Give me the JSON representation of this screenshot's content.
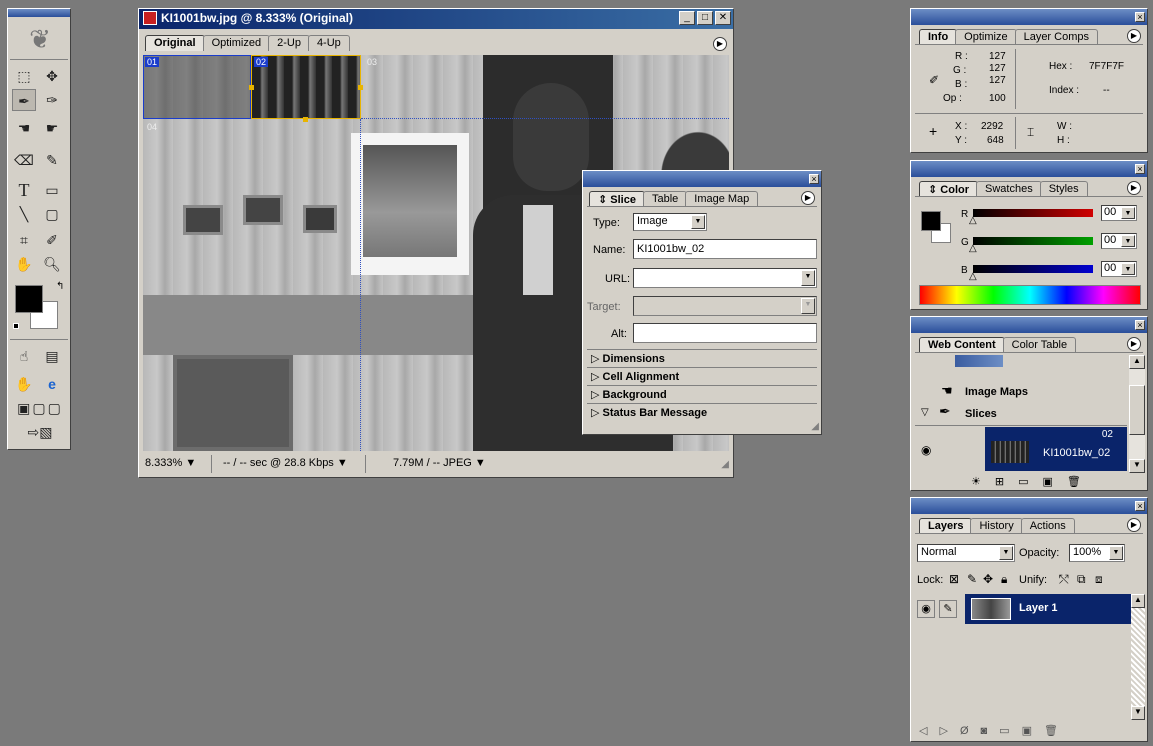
{
  "doc_window": {
    "title": "KI1001bw.jpg @ 8.333% (Original)",
    "tabs": [
      "Original",
      "Optimized",
      "2-Up",
      "4-Up"
    ],
    "active_tab": "Original",
    "slices": [
      "01",
      "02",
      "03",
      "04"
    ],
    "status": {
      "zoom": "8.333%",
      "speed": "-- / -- sec @ 28.8 Kbps",
      "size": "7.79M / -- JPEG"
    }
  },
  "slice_panel": {
    "tabs": [
      "Slice",
      "Table",
      "Image Map"
    ],
    "type_label": "Type:",
    "type_value": "Image",
    "name_label": "Name:",
    "name_value": "KI1001bw_02",
    "url_label": "URL:",
    "url_value": "",
    "target_label": "Target:",
    "target_value": "",
    "alt_label": "Alt:",
    "alt_value": "",
    "sections": [
      "Dimensions",
      "Cell Alignment",
      "Background",
      "Status Bar Message"
    ]
  },
  "info_panel": {
    "tabs": [
      "Info",
      "Optimize",
      "Layer Comps"
    ],
    "r_label": "R :",
    "r": "127",
    "g_label": "G :",
    "g": "127",
    "b_label": "B :",
    "b": "127",
    "op_label": "Op :",
    "op": "100",
    "hex_label": "Hex :",
    "hex": "7F7F7F",
    "index_label": "Index :",
    "index": "--",
    "x_label": "X :",
    "x": "2292",
    "y_label": "Y :",
    "y": "648",
    "w_label": "W :",
    "h_label": "H :"
  },
  "color_panel": {
    "tabs": [
      "Color",
      "Swatches",
      "Styles"
    ],
    "channels": [
      {
        "label": "R",
        "value": "00",
        "color": "#d00000"
      },
      {
        "label": "G",
        "value": "00",
        "color": "#00a000"
      },
      {
        "label": "B",
        "value": "00",
        "color": "#0000d0"
      }
    ]
  },
  "web_content_panel": {
    "tabs": [
      "Web Content",
      "Color Table"
    ],
    "image_maps_label": "Image Maps",
    "slices_label": "Slices",
    "slice_num": "02",
    "slice_name": "KI1001bw_02"
  },
  "layers_panel": {
    "tabs": [
      "Layers",
      "History",
      "Actions"
    ],
    "blend_mode": "Normal",
    "opacity_label": "Opacity:",
    "opacity": "100%",
    "lock_label": "Lock:",
    "unify_label": "Unify:",
    "layer_name": "Layer 1"
  },
  "colors": {
    "title_blue": "#0a246a",
    "slice_selected": "#e8b400",
    "slice_blue": "#1a3ccc",
    "layer_selected": "#0a246a"
  }
}
